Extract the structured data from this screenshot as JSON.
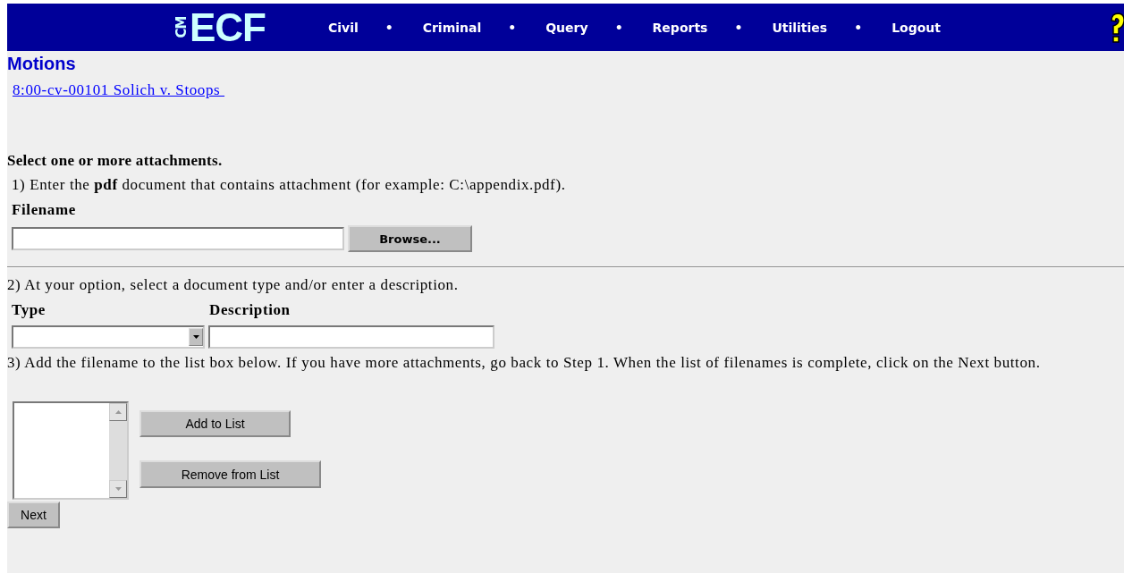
{
  "logo": {
    "vertical": "CM",
    "main": "ECF"
  },
  "nav": [
    {
      "label": "Civil",
      "separator": "•"
    },
    {
      "label": "Criminal",
      "separator": "•"
    },
    {
      "label": "Query",
      "separator": "•"
    },
    {
      "label": "Reports",
      "separator": "•"
    },
    {
      "label": "Utilities",
      "separator": "•"
    },
    {
      "label": "Logout"
    }
  ],
  "page_title": "Motions",
  "case_link": "8:00-cv-00101 Solich v. Stoops",
  "heading": "Select one or more attachments.",
  "step1": "1) Enter the **pdf** document that contains attachment (for example: C:\\appendix.pdf).",
  "filename_label": "Filename",
  "browse_button": "Browse...",
  "step2": "2) At your option, select a document type and/or enter a description.",
  "type_label": "Type",
  "description_label": "Description",
  "step3": "3) Add the filename to the list box below. If you have more attachments, go back to Step 1. When the list of filenames is complete, click on the Next button.",
  "add_button": "Add to List",
  "remove_button": "Remove from List",
  "next_button": "Next"
}
